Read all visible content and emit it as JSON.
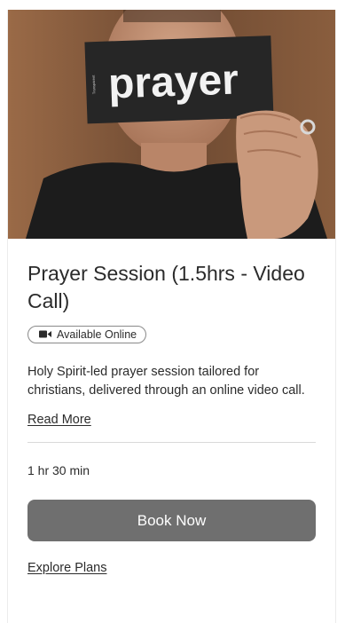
{
  "hero": {
    "card_text": "prayer",
    "card_side_text": "Transparent",
    "colors": {
      "background": "#7a5339",
      "shirt": "#1c1c1c",
      "card": "#262626",
      "card_text": "#f2f2f2",
      "skin": "#c9997c"
    }
  },
  "service": {
    "title": "Prayer Session (1.5hrs - Video Call)",
    "badge_icon": "video-camera-icon",
    "badge_label": "Available Online",
    "description": "Holy Spirit-led prayer session tailored for christians, delivered through an online video call.",
    "read_more_label": "Read More",
    "duration": "1 hr 30 min",
    "book_label": "Book Now",
    "explore_label": "Explore Plans"
  },
  "colors": {
    "button": "#6f6f6f",
    "button_text": "#ffffff",
    "text": "#2b2b2b",
    "divider": "#d9d9d9"
  }
}
